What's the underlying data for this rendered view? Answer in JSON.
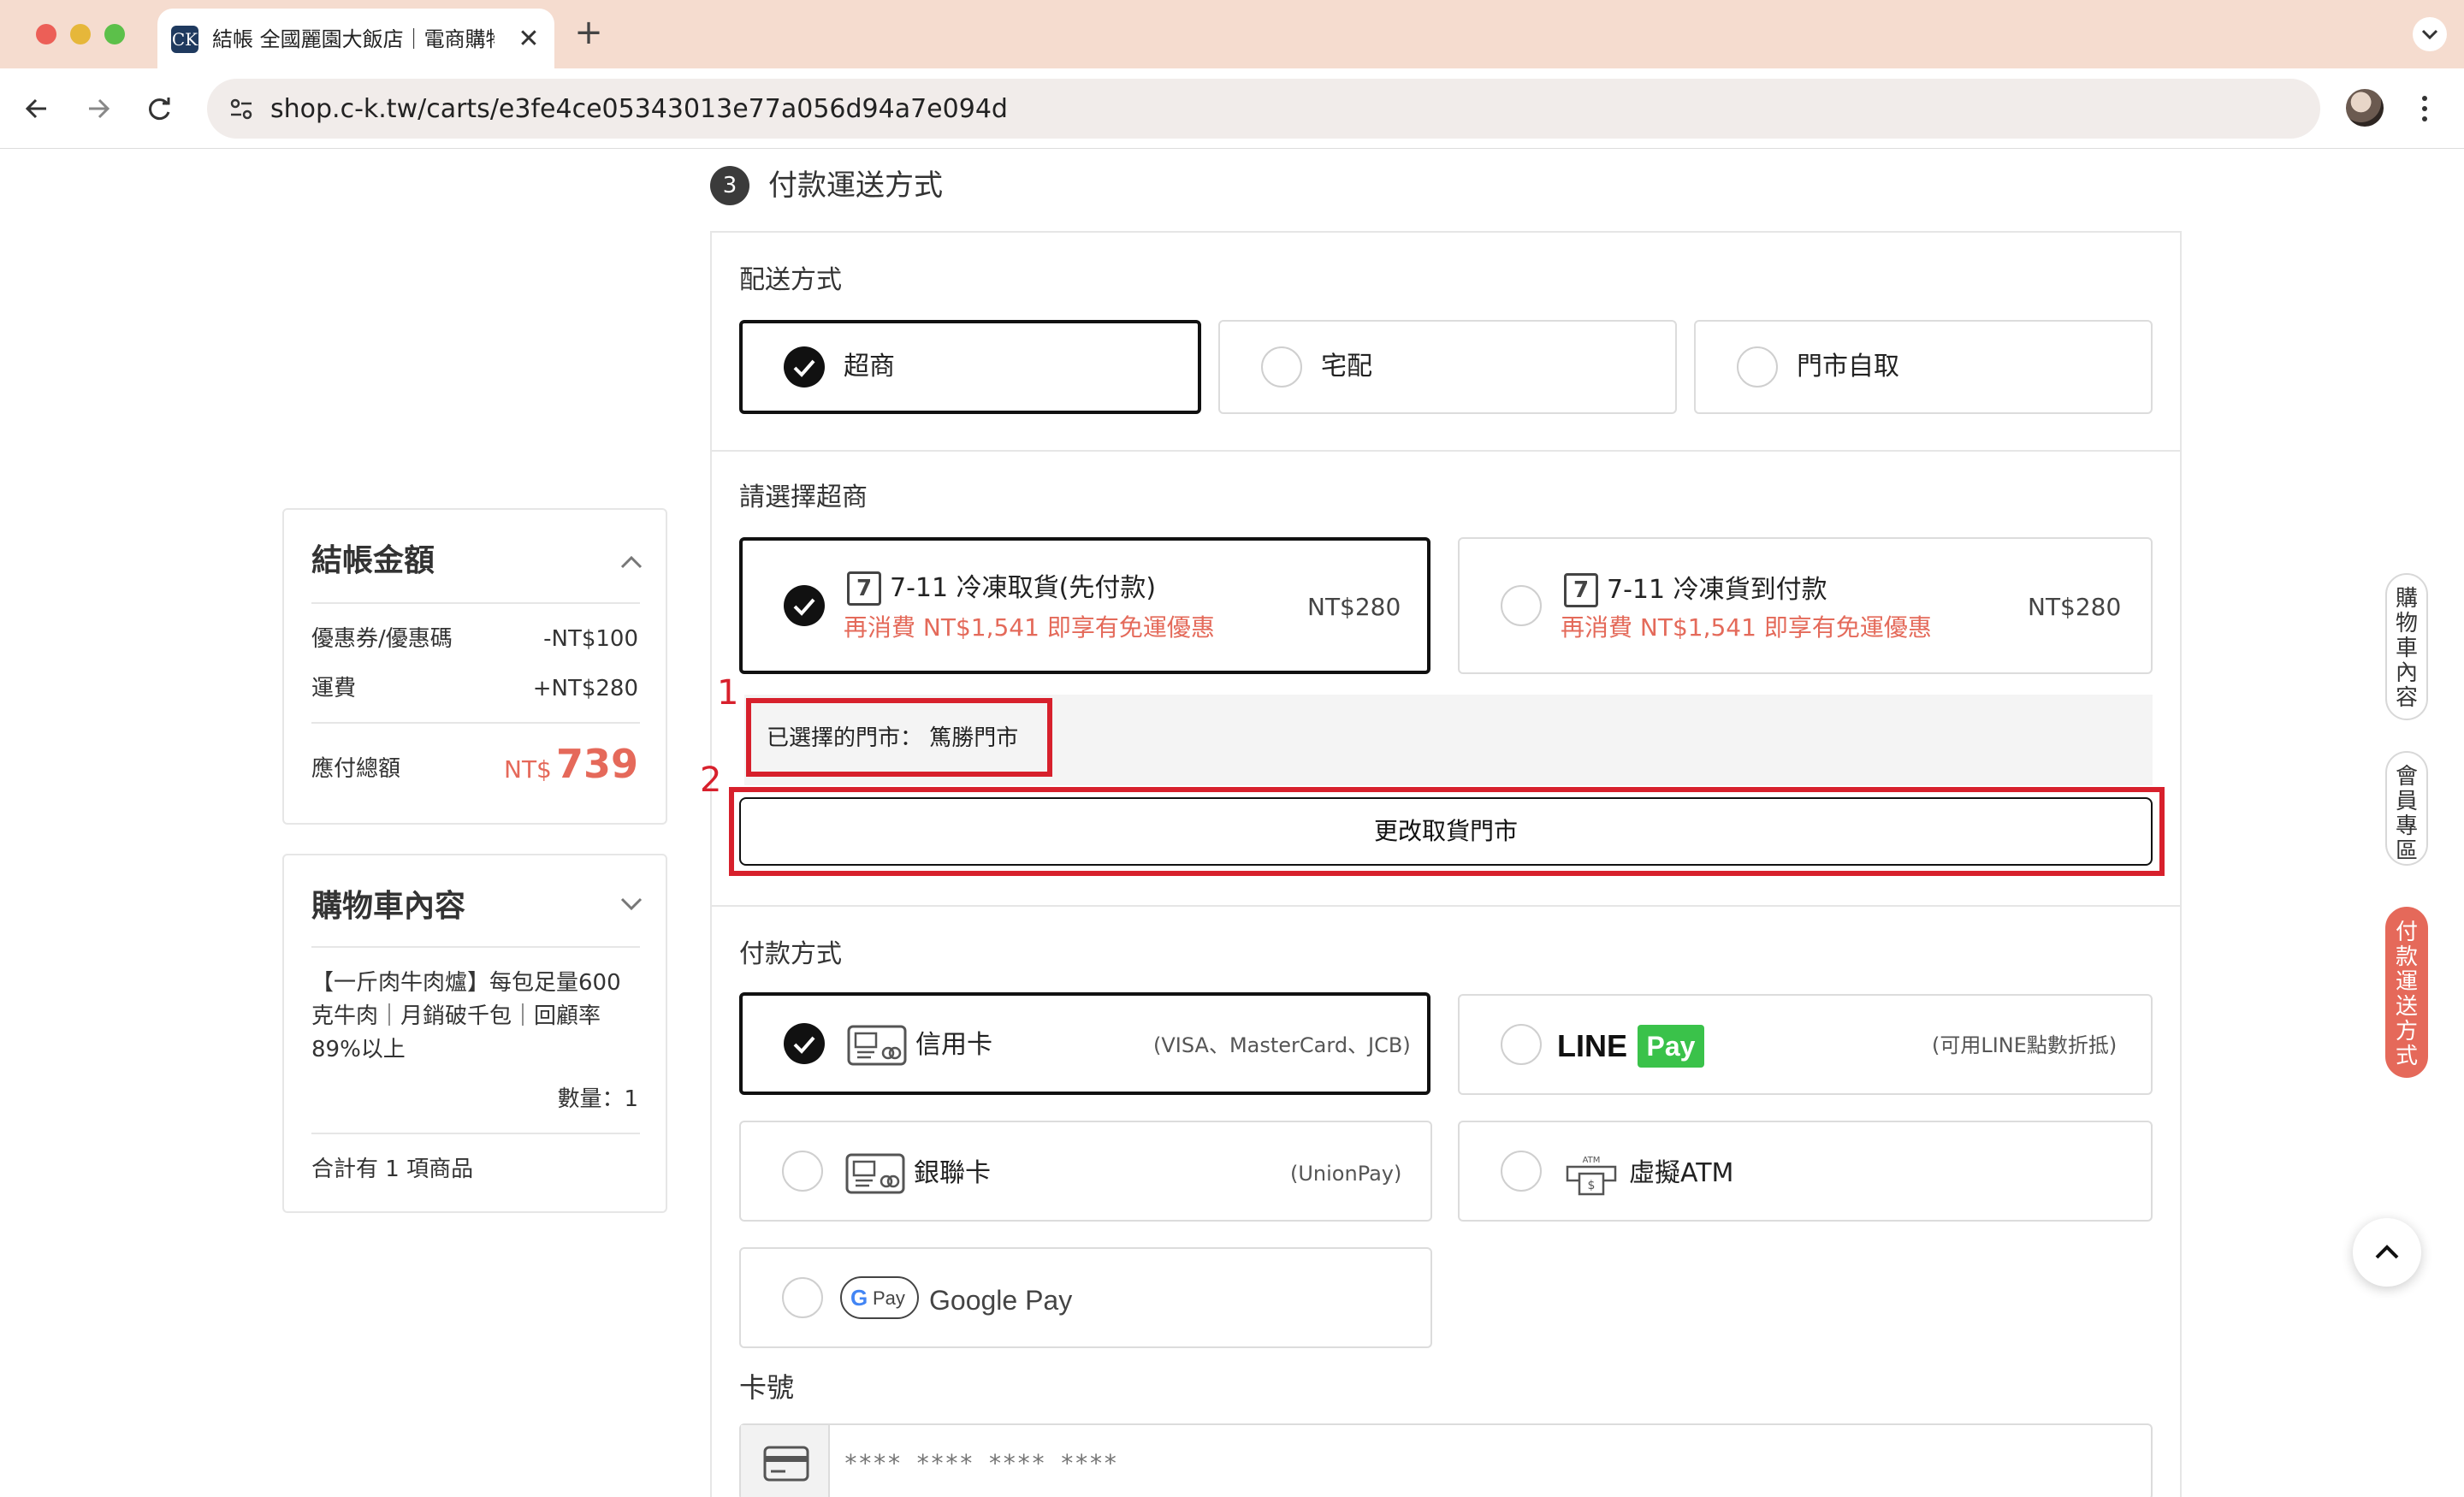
{
  "browser": {
    "tab_title": "結帳 全國麗園大飯店｜電商購物",
    "tab_favicon": "CK",
    "tab_close": "✕",
    "new_tab": "+",
    "url": "shop.c-k.tw/carts/e3fe4ce05343013e77a056d94a7e094d"
  },
  "step": {
    "number": "3",
    "title": "付款運送方式"
  },
  "shipping": {
    "label": "配送方式",
    "options": [
      {
        "label": "超商",
        "selected": true
      },
      {
        "label": "宅配",
        "selected": false
      },
      {
        "label": "門市自取",
        "selected": false
      }
    ]
  },
  "store": {
    "label": "請選擇超商",
    "options": [
      {
        "label": "7-11 冷凍取貨(先付款)",
        "price": "NT$280",
        "promo": "再消費 NT$1,541 即享有免運優惠",
        "selected": true
      },
      {
        "label": "7-11 冷凍貨到付款",
        "price": "NT$280",
        "promo": "再消費 NT$1,541 即享有免運優惠",
        "selected": false
      }
    ],
    "selected_store": "已選擇的門市： 篤勝門市",
    "change_button": "更改取貨門市"
  },
  "annotations": {
    "one": "1",
    "two": "2"
  },
  "payment": {
    "label": "付款方式",
    "options": [
      {
        "label": "信用卡",
        "hint": "(VISA、MasterCard、JCB)",
        "selected": true
      },
      {
        "label_line": "LINE",
        "label_pay": "Pay",
        "hint": "(可用LINE點數折抵)",
        "selected": false
      },
      {
        "label": "銀聯卡",
        "hint": "(UnionPay)",
        "selected": false
      },
      {
        "label": "虛擬ATM",
        "icon_text": "ATM",
        "selected": false
      },
      {
        "label": "Google Pay",
        "icon_g": "G",
        "icon_pay": "Pay",
        "selected": false
      }
    ]
  },
  "card_number": {
    "label": "卡號",
    "placeholder": "**** **** **** ****"
  },
  "summary": {
    "title": "結帳金額",
    "rows": [
      {
        "label": "優惠券/優惠碼",
        "value": "-NT$100"
      },
      {
        "label": "運費",
        "value": "+NT$280"
      }
    ],
    "total_label": "應付總額",
    "total_currency": "NT$",
    "total_value": "739"
  },
  "cart": {
    "title": "購物車內容",
    "item_name": "【一斤肉牛肉爐】每包足量600克牛肉｜月銷破千包｜回顧率89%以上",
    "quantity": "數量：1",
    "total_items": "合計有 1 項商品"
  },
  "side_nav": [
    {
      "label": "購物車內容"
    },
    {
      "label": "會員專區"
    },
    {
      "label": "付款運送方式"
    }
  ],
  "colors": {
    "accent": "#e5695a",
    "annotation": "#d7202c",
    "line_green": "#3ac24a"
  }
}
